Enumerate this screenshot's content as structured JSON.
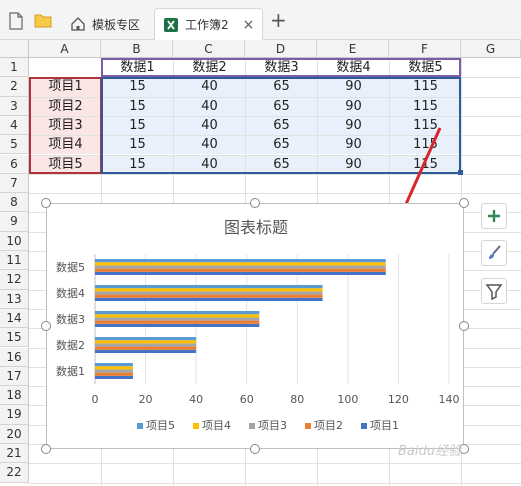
{
  "tabs": [
    {
      "label": "模板专区"
    },
    {
      "label": "工作簿2",
      "close": "×"
    }
  ],
  "add_tab": "+",
  "columns": [
    "A",
    "B",
    "C",
    "D",
    "E",
    "F",
    "G"
  ],
  "rows": [
    "1",
    "2",
    "3",
    "4",
    "5",
    "6",
    "7",
    "8",
    "9",
    "10",
    "11",
    "12",
    "13",
    "14",
    "15",
    "16",
    "17",
    "18",
    "19",
    "20",
    "21",
    "22"
  ],
  "table": {
    "headers": [
      "数据1",
      "数据2",
      "数据3",
      "数据4",
      "数据5"
    ],
    "row_labels": [
      "项目1",
      "项目2",
      "项目3",
      "项目4",
      "项目5"
    ],
    "values": [
      [
        "15",
        "40",
        "65",
        "90",
        "115"
      ],
      [
        "15",
        "40",
        "65",
        "90",
        "115"
      ],
      [
        "15",
        "40",
        "65",
        "90",
        "115"
      ],
      [
        "15",
        "40",
        "65",
        "90",
        "115"
      ],
      [
        "15",
        "40",
        "65",
        "90",
        "115"
      ]
    ]
  },
  "chart_data": {
    "type": "bar",
    "orientation": "horizontal",
    "title": "图表标题",
    "categories": [
      "数据1",
      "数据2",
      "数据3",
      "数据4",
      "数据5"
    ],
    "series": [
      {
        "name": "项目1",
        "color": "#4472c4",
        "values": [
          15,
          40,
          65,
          90,
          115
        ]
      },
      {
        "name": "项目2",
        "color": "#ed7d31",
        "values": [
          15,
          40,
          65,
          90,
          115
        ]
      },
      {
        "name": "项目3",
        "color": "#a5a5a5",
        "values": [
          15,
          40,
          65,
          90,
          115
        ]
      },
      {
        "name": "项目4",
        "color": "#ffc000",
        "values": [
          15,
          40,
          65,
          90,
          115
        ]
      },
      {
        "name": "项目5",
        "color": "#5b9bd5",
        "values": [
          15,
          40,
          65,
          90,
          115
        ]
      }
    ],
    "xticks": [
      0,
      20,
      40,
      60,
      80,
      100,
      120,
      140
    ],
    "xlim": [
      0,
      140
    ],
    "grid": true,
    "legend": "bottom",
    "legend_order": [
      "项目5",
      "项目4",
      "项目3",
      "项目2",
      "项目1"
    ]
  },
  "watermark": "Baidu经验",
  "colors": {
    "accent_green": "#1e7145",
    "arrow_red": "#d9262c"
  }
}
